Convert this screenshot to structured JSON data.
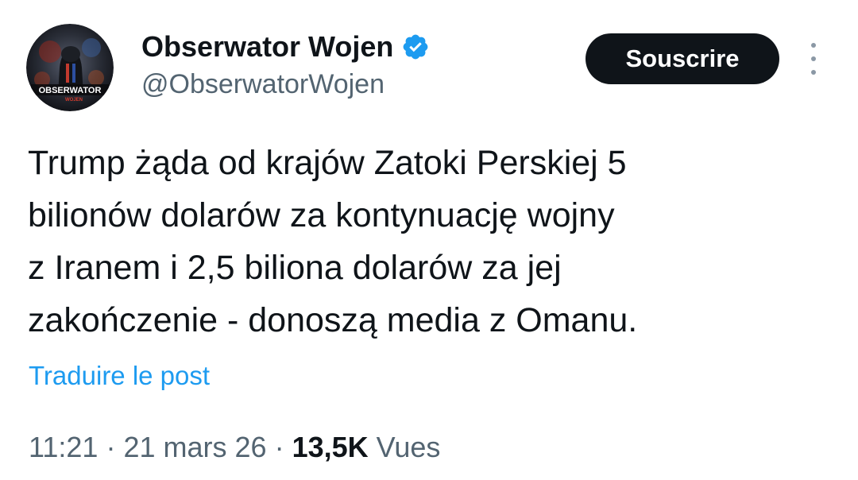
{
  "author": {
    "display_name": "Obserwator Wojen",
    "handle": "@ObserwatorWojen",
    "verified": true,
    "avatar_text": "OBSERWATOR",
    "avatar_subtext": "WOJEN"
  },
  "header": {
    "subscribe_label": "Souscrire",
    "more_icon": "more-vertical-icon"
  },
  "tweet": {
    "lines": [
      "Trump żąda od krajów Zatoki Perskiej 5",
      "bilionów dolarów za kontynuację wojny",
      "z Iranem i 2,5 biliona dolarów za jej",
      "zakończenie - donoszą media z Omanu."
    ],
    "translate_label": "Traduire le post"
  },
  "meta": {
    "time": "11:21",
    "date": "21 mars 26",
    "separator": "·",
    "views_count": "13,5K",
    "views_label": "Vues"
  },
  "colors": {
    "accent": "#1d9bf0",
    "text": "#0f1419",
    "secondary": "#536471",
    "button_bg": "#0f1419"
  }
}
